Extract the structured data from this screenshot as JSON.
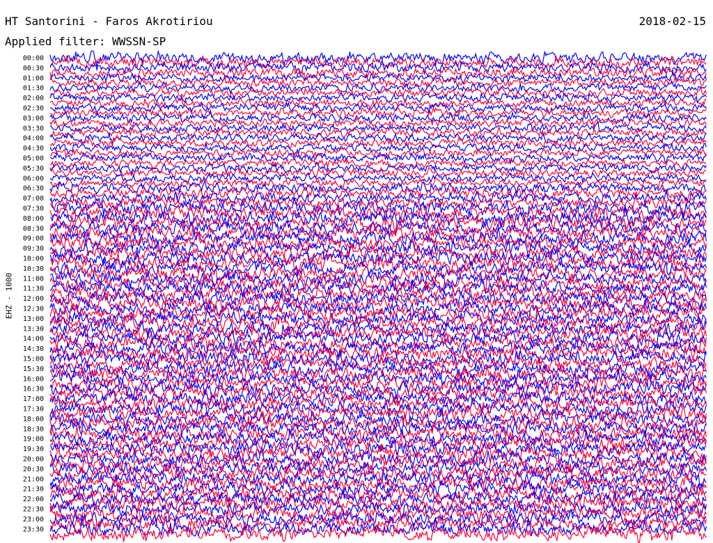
{
  "header": {
    "station": "HT Santorini - Faros Akrotiriou",
    "date": "2018-02-15",
    "filter_label": "Applied filter:",
    "filter_value": "WWSSN-SP"
  },
  "chart_data": {
    "type": "line",
    "title": "HT Santorini - Faros Akrotiriou",
    "subtitle": "Applied filter: WWSSN-SP",
    "ylabel": "EHZ - 1000",
    "xlabel": "",
    "row_interval_minutes": 15,
    "tick_labels": [
      "00:00",
      "00:30",
      "01:00",
      "01:30",
      "02:00",
      "02:30",
      "03:00",
      "03:30",
      "04:00",
      "04:30",
      "05:00",
      "05:30",
      "06:00",
      "06:30",
      "07:00",
      "07:30",
      "08:00",
      "08:30",
      "09:00",
      "09:30",
      "10:00",
      "10:30",
      "11:00",
      "11:30",
      "12:00",
      "12:30",
      "13:00",
      "13:30",
      "14:00",
      "14:30",
      "15:00",
      "15:30",
      "16:00",
      "16:30",
      "17:00",
      "17:30",
      "18:00",
      "18:30",
      "19:00",
      "19:30",
      "20:00",
      "20:30",
      "21:00",
      "21:30",
      "22:00",
      "22:30",
      "23:00",
      "23:30"
    ],
    "series": [
      {
        "color": "#0000ff",
        "rows": "00:00, 00:30, ... (every :00 and :30 trace)"
      },
      {
        "color": "#ff0033",
        "rows": "00:15, 00:45, ... (every :15 and :45 trace)"
      }
    ],
    "colors": {
      "trace_a": "#0000ff",
      "trace_b": "#ff0033",
      "background": "#ffffff"
    },
    "grid": false
  }
}
